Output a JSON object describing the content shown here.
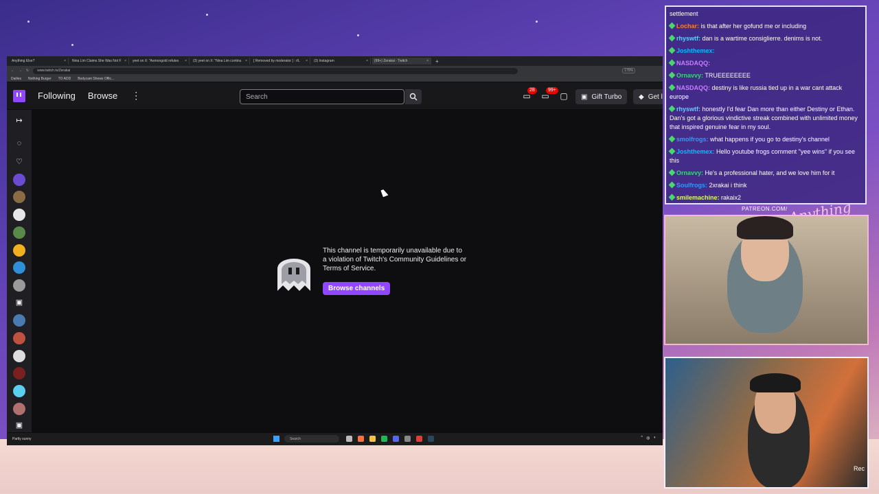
{
  "browser": {
    "tabs": [
      {
        "label": "Anything Else?"
      },
      {
        "label": "Nina Lim Claims She Was Not F"
      },
      {
        "label": "yeet on X: \"Asmongold refutes"
      },
      {
        "label": "(3) yeet on X: \"Nina Lim continu"
      },
      {
        "label": "[ Removed by moderator ] : r/L"
      },
      {
        "label": "(3) Instagram"
      },
      {
        "label": "(99+) Zerakai - Twitch"
      }
    ],
    "url": "www.twitch.tv/Zerakai",
    "zoom": "170%",
    "bookmarks": [
      "Dailies",
      "Nothing Burger",
      "TO ADD",
      "Bodycam Shows Offic..."
    ]
  },
  "twitch": {
    "nav": {
      "following": "Following",
      "browse": "Browse",
      "more": "⋮"
    },
    "search_placeholder": "Search",
    "inbox_badge": "28",
    "notif_badge": "99+",
    "gift_turbo": "Gift Turbo",
    "get_label": "Get l",
    "unavailable_message": "This channel is temporarily unavailable due to a violation of Twitch's Community Guidelines or Terms of Service.",
    "browse_channels": "Browse channels"
  },
  "taskbar": {
    "weather": "Partly sunny",
    "search": "Search"
  },
  "chat": {
    "lines": [
      {
        "user": "",
        "text": "settlement",
        "color": "#ffffff"
      },
      {
        "user": "Lochar:",
        "text": "is that after her gofund me or including",
        "color": "#ff7f24"
      },
      {
        "user": "rhyswtf:",
        "text": "dan is a wartime consiglierre. denims is not.",
        "color": "#5fd0ff"
      },
      {
        "user": "Joshthemex:",
        "text": "",
        "color": "#00bfff"
      },
      {
        "user": "NASDAQQ:",
        "text": "",
        "color": "#c77dff"
      },
      {
        "user": "Ornavvy:",
        "text": "TRUEEEEEEEE",
        "color": "#37d67a"
      },
      {
        "user": "NASDAQQ:",
        "text": "destiny is like russia tied up in a war cant attack europe",
        "color": "#c77dff"
      },
      {
        "user": "rhyswtf:",
        "text": "honestly I'd fear Dan more than either Destiny or Ethan. Dan's got a glorious vindictive streak combined with unlimited money that inspired genuine fear in my soul.",
        "color": "#5fd0ff"
      },
      {
        "user": "smolfrogs:",
        "text": "what happens if you go to destiny's channel",
        "color": "#2e9bff"
      },
      {
        "user": "Joshthemex:",
        "text": "Hello youtube frogs  comment \"yee wins\" if you see this",
        "color": "#00bfff"
      },
      {
        "user": "Ornavvy:",
        "text": "He's a professional hater, and we love him for it",
        "color": "#37d67a"
      },
      {
        "user": "Soulfrogs:",
        "text": "2xrakai i think",
        "color": "#2e9bff"
      },
      {
        "user": "smilemachine:",
        "text": "rakaix2",
        "color": "#d6ff5a"
      }
    ]
  },
  "overlay": {
    "patreon": "PATREON.COM/",
    "anything_else": "Anything Else?",
    "cam2_label": "Rec"
  },
  "colors": {
    "twitch_purple": "#9146ff",
    "badge_red": "#eb0400"
  }
}
